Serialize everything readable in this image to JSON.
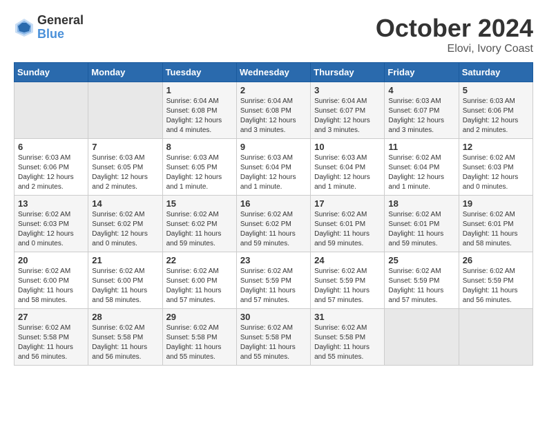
{
  "logo": {
    "general": "General",
    "blue": "Blue"
  },
  "title": {
    "month": "October 2024",
    "location": "Elovi, Ivory Coast"
  },
  "days_of_week": [
    "Sunday",
    "Monday",
    "Tuesday",
    "Wednesday",
    "Thursday",
    "Friday",
    "Saturday"
  ],
  "weeks": [
    [
      {
        "day": "",
        "info": ""
      },
      {
        "day": "",
        "info": ""
      },
      {
        "day": "1",
        "info": "Sunrise: 6:04 AM\nSunset: 6:08 PM\nDaylight: 12 hours\nand 4 minutes."
      },
      {
        "day": "2",
        "info": "Sunrise: 6:04 AM\nSunset: 6:08 PM\nDaylight: 12 hours\nand 3 minutes."
      },
      {
        "day": "3",
        "info": "Sunrise: 6:04 AM\nSunset: 6:07 PM\nDaylight: 12 hours\nand 3 minutes."
      },
      {
        "day": "4",
        "info": "Sunrise: 6:03 AM\nSunset: 6:07 PM\nDaylight: 12 hours\nand 3 minutes."
      },
      {
        "day": "5",
        "info": "Sunrise: 6:03 AM\nSunset: 6:06 PM\nDaylight: 12 hours\nand 2 minutes."
      }
    ],
    [
      {
        "day": "6",
        "info": "Sunrise: 6:03 AM\nSunset: 6:06 PM\nDaylight: 12 hours\nand 2 minutes."
      },
      {
        "day": "7",
        "info": "Sunrise: 6:03 AM\nSunset: 6:05 PM\nDaylight: 12 hours\nand 2 minutes."
      },
      {
        "day": "8",
        "info": "Sunrise: 6:03 AM\nSunset: 6:05 PM\nDaylight: 12 hours\nand 1 minute."
      },
      {
        "day": "9",
        "info": "Sunrise: 6:03 AM\nSunset: 6:04 PM\nDaylight: 12 hours\nand 1 minute."
      },
      {
        "day": "10",
        "info": "Sunrise: 6:03 AM\nSunset: 6:04 PM\nDaylight: 12 hours\nand 1 minute."
      },
      {
        "day": "11",
        "info": "Sunrise: 6:02 AM\nSunset: 6:04 PM\nDaylight: 12 hours\nand 1 minute."
      },
      {
        "day": "12",
        "info": "Sunrise: 6:02 AM\nSunset: 6:03 PM\nDaylight: 12 hours\nand 0 minutes."
      }
    ],
    [
      {
        "day": "13",
        "info": "Sunrise: 6:02 AM\nSunset: 6:03 PM\nDaylight: 12 hours\nand 0 minutes."
      },
      {
        "day": "14",
        "info": "Sunrise: 6:02 AM\nSunset: 6:02 PM\nDaylight: 12 hours\nand 0 minutes."
      },
      {
        "day": "15",
        "info": "Sunrise: 6:02 AM\nSunset: 6:02 PM\nDaylight: 11 hours\nand 59 minutes."
      },
      {
        "day": "16",
        "info": "Sunrise: 6:02 AM\nSunset: 6:02 PM\nDaylight: 11 hours\nand 59 minutes."
      },
      {
        "day": "17",
        "info": "Sunrise: 6:02 AM\nSunset: 6:01 PM\nDaylight: 11 hours\nand 59 minutes."
      },
      {
        "day": "18",
        "info": "Sunrise: 6:02 AM\nSunset: 6:01 PM\nDaylight: 11 hours\nand 59 minutes."
      },
      {
        "day": "19",
        "info": "Sunrise: 6:02 AM\nSunset: 6:01 PM\nDaylight: 11 hours\nand 58 minutes."
      }
    ],
    [
      {
        "day": "20",
        "info": "Sunrise: 6:02 AM\nSunset: 6:00 PM\nDaylight: 11 hours\nand 58 minutes."
      },
      {
        "day": "21",
        "info": "Sunrise: 6:02 AM\nSunset: 6:00 PM\nDaylight: 11 hours\nand 58 minutes."
      },
      {
        "day": "22",
        "info": "Sunrise: 6:02 AM\nSunset: 6:00 PM\nDaylight: 11 hours\nand 57 minutes."
      },
      {
        "day": "23",
        "info": "Sunrise: 6:02 AM\nSunset: 5:59 PM\nDaylight: 11 hours\nand 57 minutes."
      },
      {
        "day": "24",
        "info": "Sunrise: 6:02 AM\nSunset: 5:59 PM\nDaylight: 11 hours\nand 57 minutes."
      },
      {
        "day": "25",
        "info": "Sunrise: 6:02 AM\nSunset: 5:59 PM\nDaylight: 11 hours\nand 57 minutes."
      },
      {
        "day": "26",
        "info": "Sunrise: 6:02 AM\nSunset: 5:59 PM\nDaylight: 11 hours\nand 56 minutes."
      }
    ],
    [
      {
        "day": "27",
        "info": "Sunrise: 6:02 AM\nSunset: 5:58 PM\nDaylight: 11 hours\nand 56 minutes."
      },
      {
        "day": "28",
        "info": "Sunrise: 6:02 AM\nSunset: 5:58 PM\nDaylight: 11 hours\nand 56 minutes."
      },
      {
        "day": "29",
        "info": "Sunrise: 6:02 AM\nSunset: 5:58 PM\nDaylight: 11 hours\nand 55 minutes."
      },
      {
        "day": "30",
        "info": "Sunrise: 6:02 AM\nSunset: 5:58 PM\nDaylight: 11 hours\nand 55 minutes."
      },
      {
        "day": "31",
        "info": "Sunrise: 6:02 AM\nSunset: 5:58 PM\nDaylight: 11 hours\nand 55 minutes."
      },
      {
        "day": "",
        "info": ""
      },
      {
        "day": "",
        "info": ""
      }
    ]
  ]
}
